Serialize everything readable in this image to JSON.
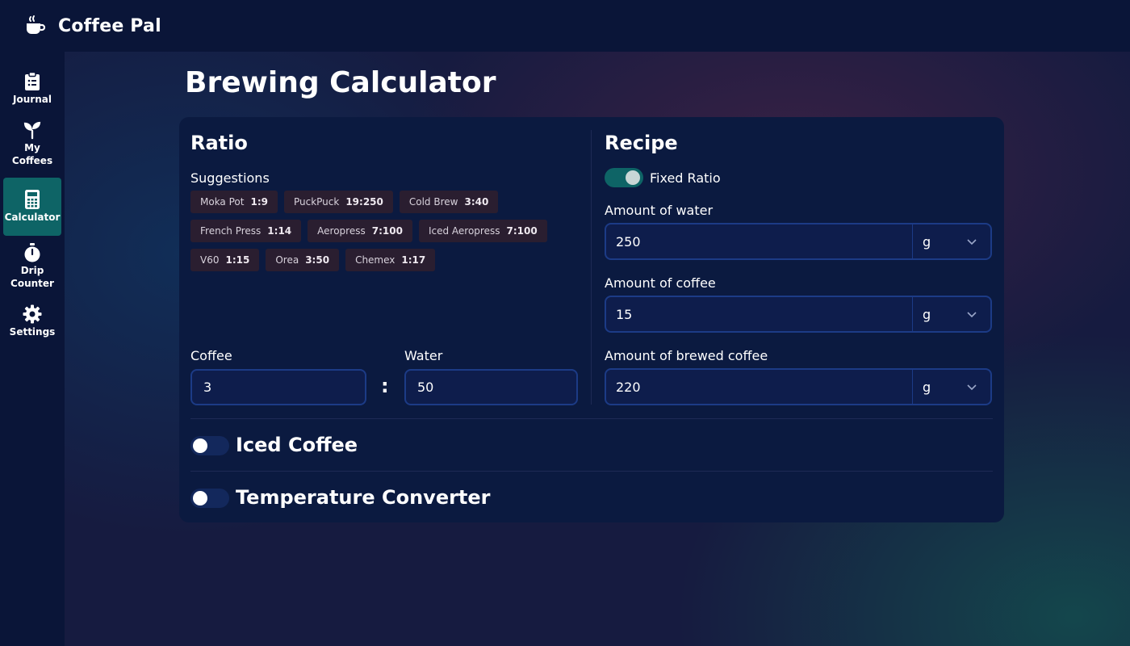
{
  "app": {
    "title": "Coffee Pal",
    "logo_icon": "coffee-cup-icon"
  },
  "sidebar": {
    "items": [
      {
        "label": "Journal",
        "icon": "clipboard-list-icon",
        "active": false
      },
      {
        "label": "My\nCoffees",
        "icon": "sprout-icon",
        "active": false
      },
      {
        "label": "Calculator",
        "icon": "calculator-icon",
        "active": true
      },
      {
        "label": "Drip\nCounter",
        "icon": "stopwatch-icon",
        "active": false
      },
      {
        "label": "Settings",
        "icon": "gear-icon",
        "active": false
      }
    ]
  },
  "page": {
    "title": "Brewing Calculator"
  },
  "ratio": {
    "title": "Ratio",
    "suggestions_label": "Suggestions",
    "suggestions": [
      [
        {
          "name": "Moka Pot",
          "ratio": "1:9"
        },
        {
          "name": "PuckPuck",
          "ratio": "19:250"
        },
        {
          "name": "Cold Brew",
          "ratio": "3:40"
        }
      ],
      [
        {
          "name": "French Press",
          "ratio": "1:14"
        },
        {
          "name": "Aeropress",
          "ratio": "7:100"
        },
        {
          "name": "Iced Aeropress",
          "ratio": "7:100"
        }
      ],
      [
        {
          "name": "V60",
          "ratio": "1:15"
        },
        {
          "name": "Orea",
          "ratio": "3:50"
        },
        {
          "name": "Chemex",
          "ratio": "1:17"
        }
      ]
    ],
    "coffee_label": "Coffee",
    "coffee_value": "3",
    "separator": ":",
    "water_label": "Water",
    "water_value": "50"
  },
  "recipe": {
    "title": "Recipe",
    "fixed_ratio_label": "Fixed Ratio",
    "fixed_ratio_on": true,
    "water_label": "Amount of water",
    "water_value": "250",
    "water_unit": "g",
    "coffee_label": "Amount of coffee",
    "coffee_value": "15",
    "coffee_unit": "g",
    "brewed_label": "Amount of brewed coffee",
    "brewed_value": "220",
    "brewed_unit": "g"
  },
  "sections": {
    "iced_label": "Iced Coffee",
    "iced_on": false,
    "temp_label": "Temperature Converter",
    "temp_on": false
  },
  "colors": {
    "accent": "#0e6466",
    "background": "#0a1538",
    "card": "#0b1a40",
    "chip": "#2a1e30"
  }
}
